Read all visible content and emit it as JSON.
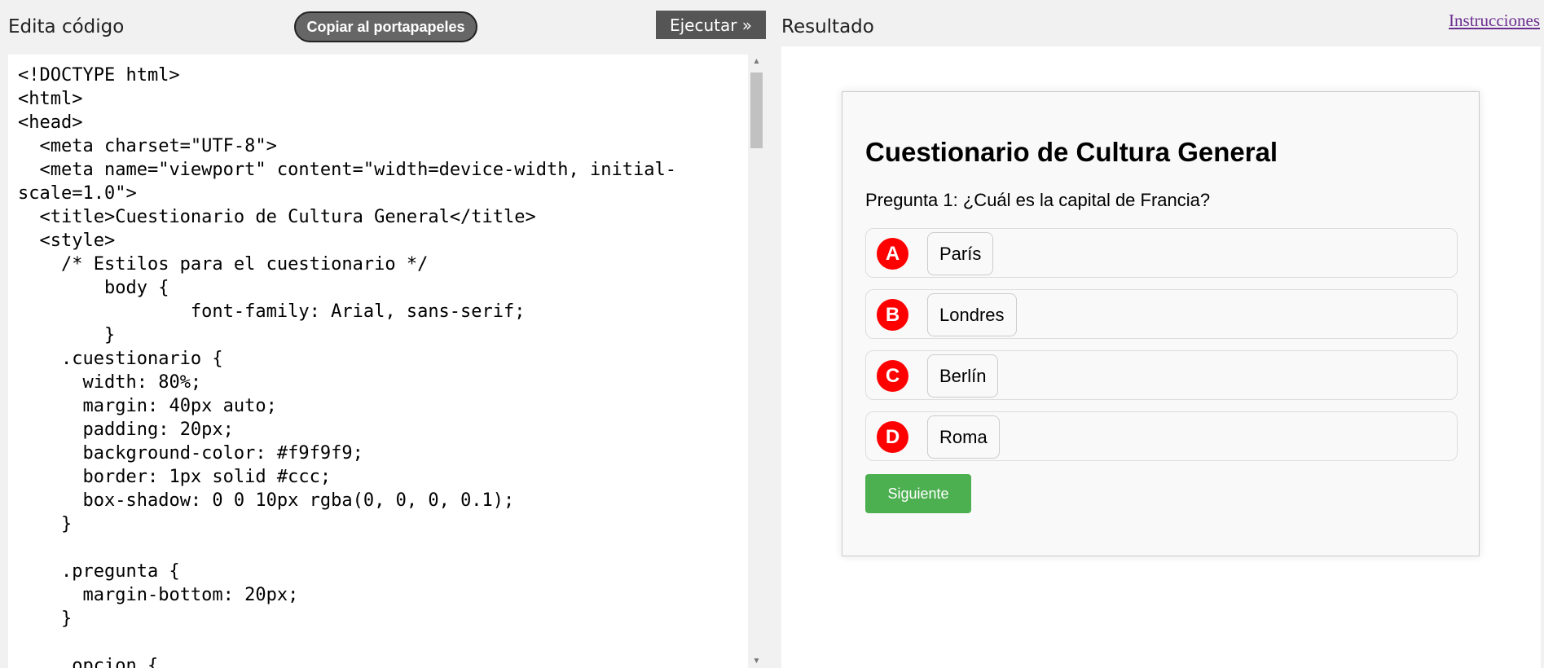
{
  "header": {
    "left_title": "Edita código",
    "copy_button": "Copiar al portapapeles",
    "run_button": "Ejecutar »",
    "right_title": "Resultado",
    "instructions_link": "Instrucciones"
  },
  "editor": {
    "code": "<!DOCTYPE html>\n<html>\n<head>\n  <meta charset=\"UTF-8\">\n  <meta name=\"viewport\" content=\"width=device-width, initial-scale=1.0\">\n  <title>Cuestionario de Cultura General</title>\n  <style>\n    /* Estilos para el cuestionario */\n        body {\n                font-family: Arial, sans-serif;\n        }\n    .cuestionario {\n      width: 80%;\n      margin: 40px auto;\n      padding: 20px;\n      background-color: #f9f9f9;\n      border: 1px solid #ccc;\n      box-shadow: 0 0 10px rgba(0, 0, 0, 0.1);\n    }\n\n    .pregunta {\n      margin-bottom: 20px;\n    }\n\n    .opcion {",
    "scroll_up_icon": "▲",
    "scroll_down_icon": "▼"
  },
  "result": {
    "quiz_title": "Cuestionario de Cultura General",
    "question": "Pregunta 1: ¿Cuál es la capital de Francia?",
    "options": [
      {
        "letter": "A",
        "text": "París"
      },
      {
        "letter": "B",
        "text": "Londres"
      },
      {
        "letter": "C",
        "text": "Berlín"
      },
      {
        "letter": "D",
        "text": "Roma"
      }
    ],
    "next_button": "Siguiente"
  },
  "colors": {
    "letter_badge": "#ff0000",
    "next_button": "#4caf50",
    "run_button": "#555555",
    "link": "#6b2d90"
  }
}
